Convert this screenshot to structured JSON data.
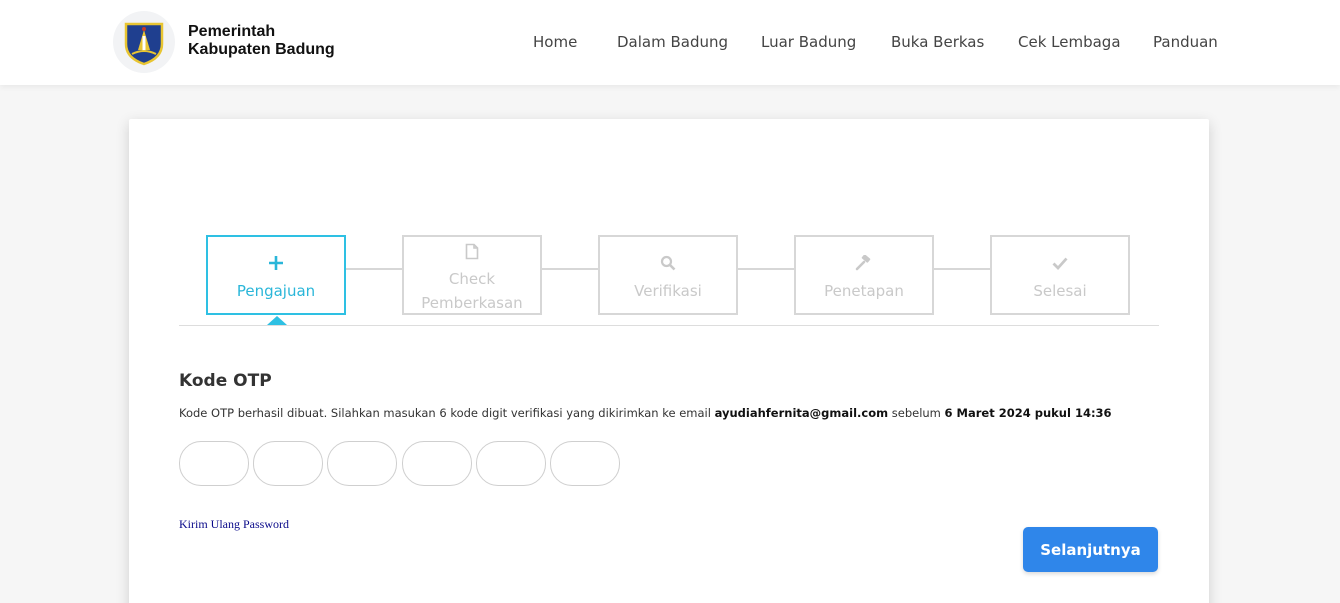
{
  "header": {
    "brand_line1": "Pemerintah",
    "brand_line2": "Kabupaten Badung",
    "nav": [
      "Home",
      "Dalam Badung",
      "Luar Badung",
      "Buka Berkas",
      "Cek Lembaga",
      "Panduan"
    ]
  },
  "stepper": {
    "steps": [
      {
        "label": "Pengajuan",
        "icon": "plus-icon",
        "active": true
      },
      {
        "label1": "Check",
        "label2": "Pemberkasan",
        "icon": "document-icon",
        "active": false
      },
      {
        "label": "Verifikasi",
        "icon": "search-icon",
        "active": false
      },
      {
        "label": "Penetapan",
        "icon": "gavel-icon",
        "active": false
      },
      {
        "label": "Selesai",
        "icon": "check-icon",
        "active": false
      }
    ]
  },
  "otp": {
    "title": "Kode OTP",
    "desc_prefix": "Kode OTP berhasil dibuat. Silahkan masukan 6 kode digit verifikasi yang dikirimkan ke email ",
    "email": "ayudiahfernita@gmail.com",
    "desc_middle": " sebelum ",
    "deadline": "6 Maret 2024 pukul 14:36",
    "digits": [
      "",
      "",
      "",
      "",
      "",
      ""
    ]
  },
  "actions": {
    "resend_label": "Kirim Ulang Password",
    "next_label": "Selanjutnya"
  },
  "colors": {
    "accent": "#2ec0e3",
    "primary_button": "#2f86ea",
    "inactive": "#d7d7d7"
  }
}
